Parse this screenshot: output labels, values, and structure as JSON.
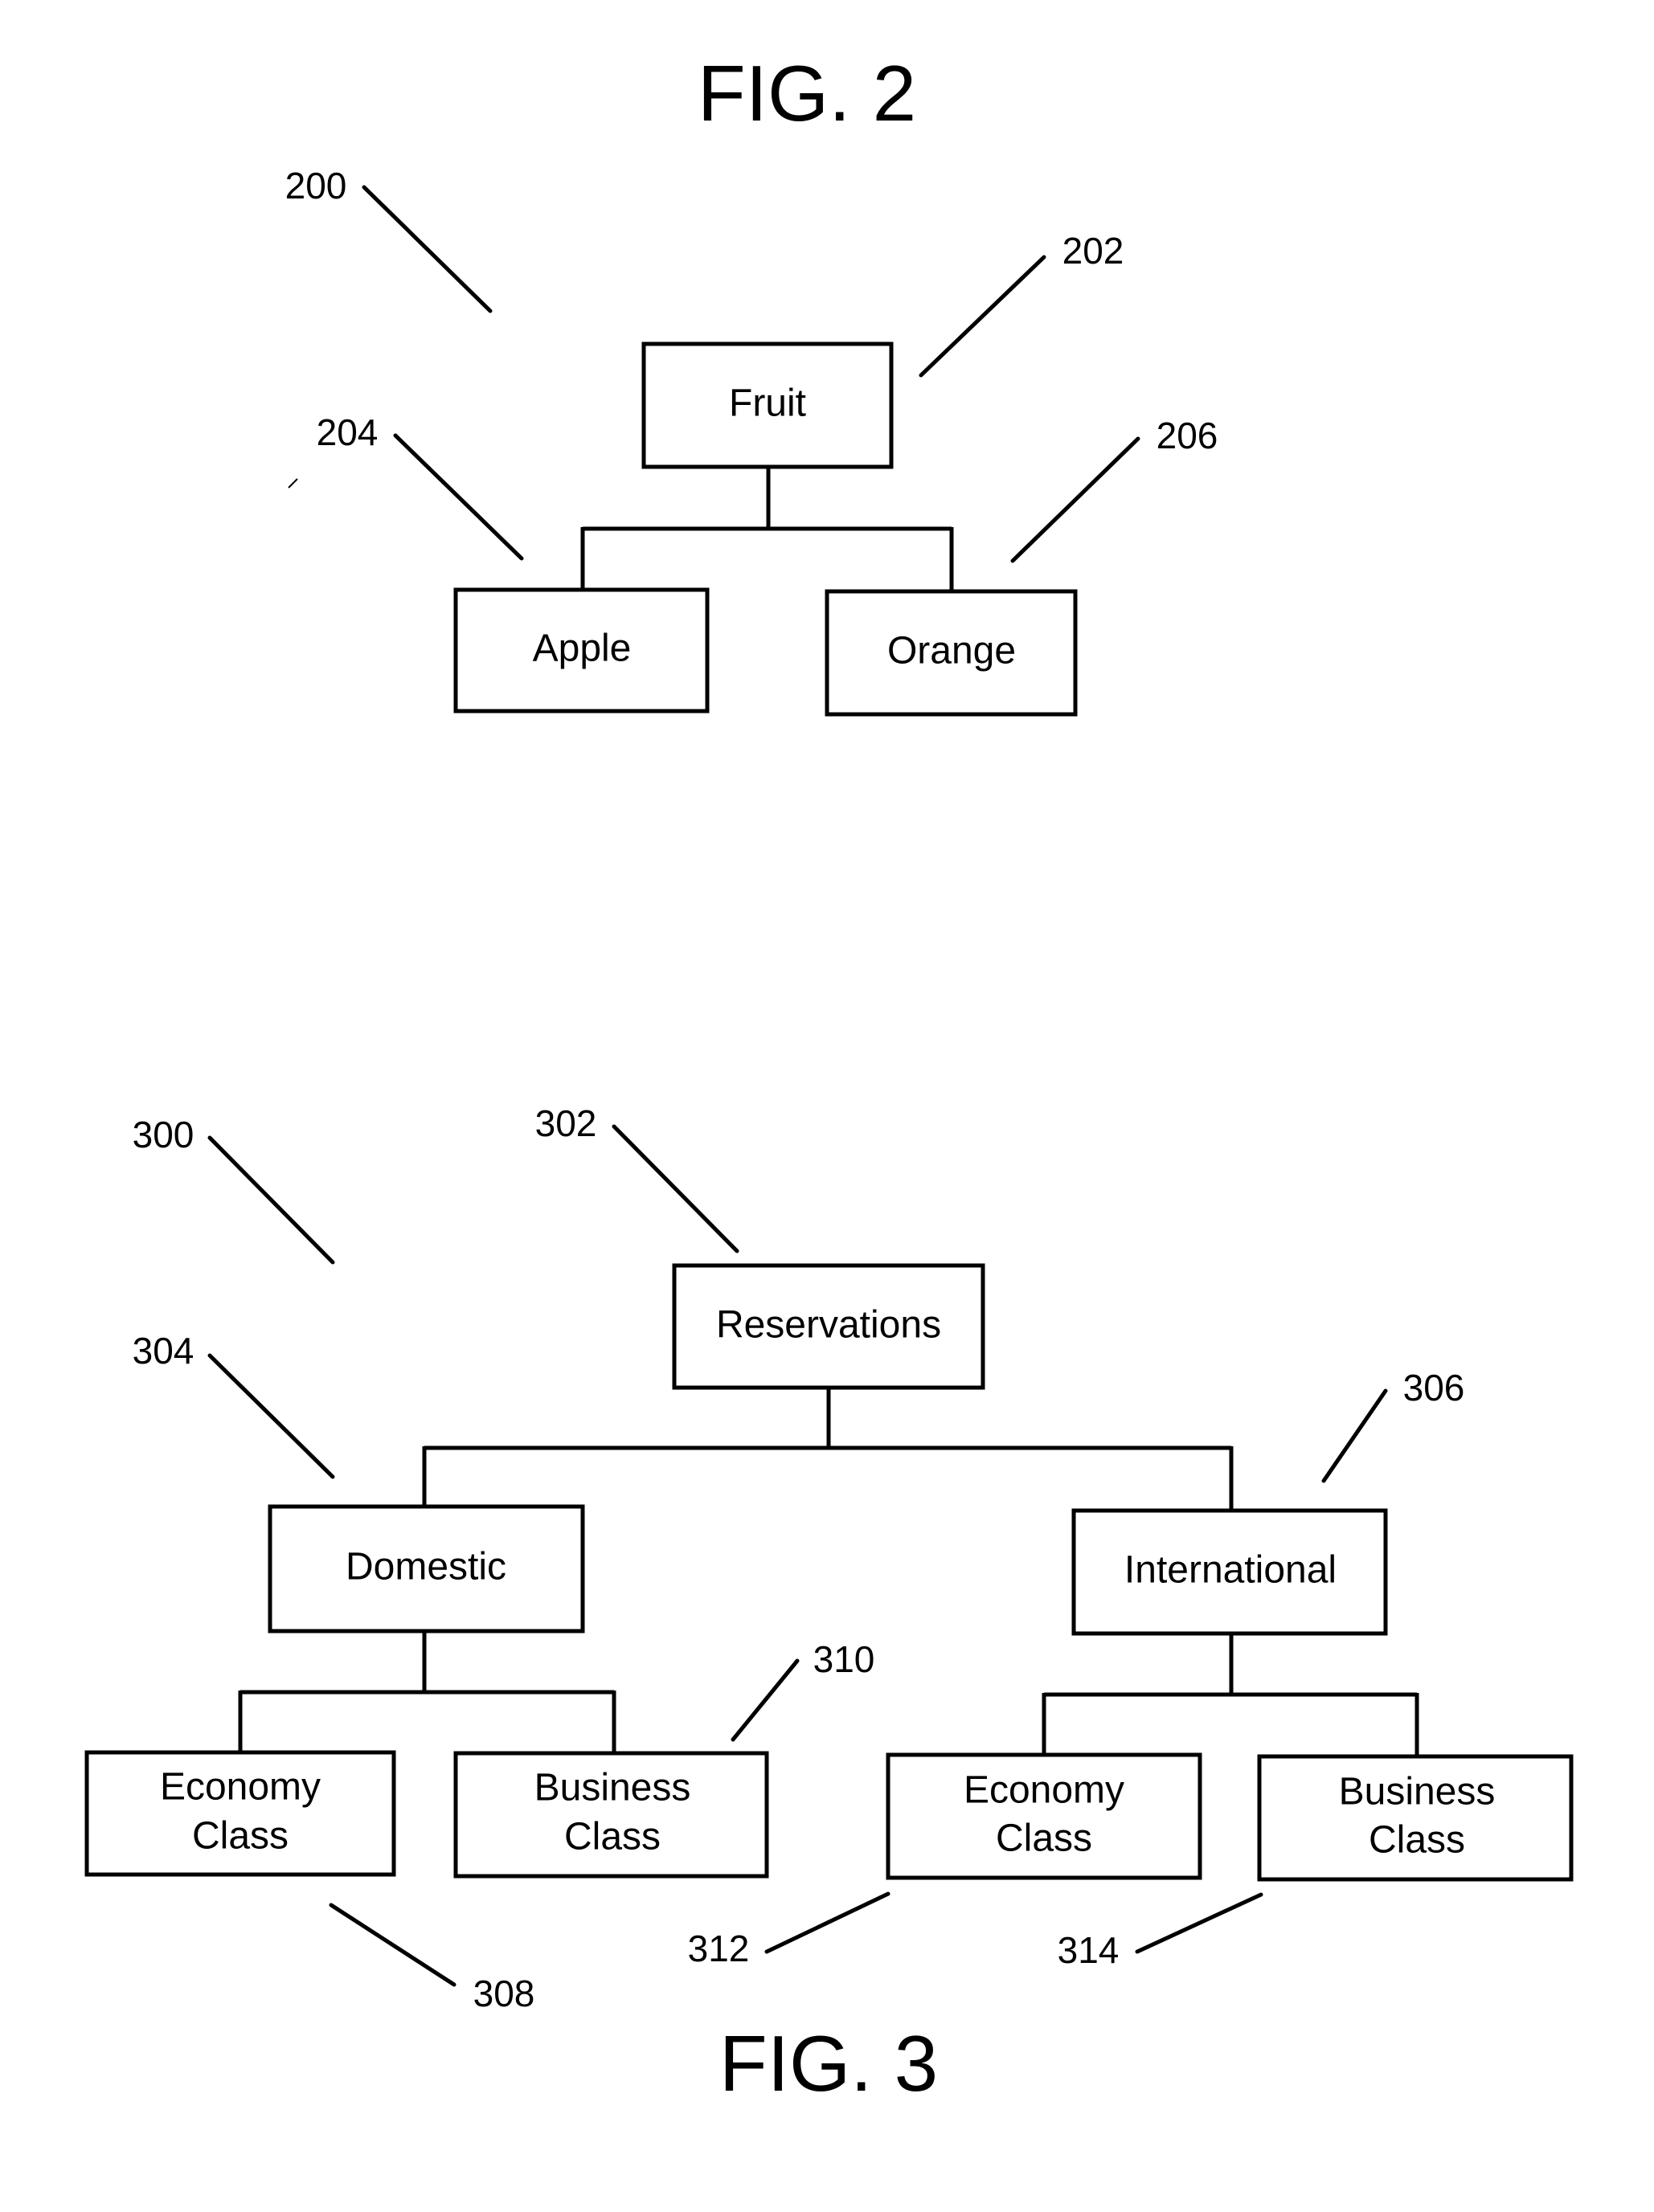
{
  "fig2": {
    "title": "FIG. 2",
    "ref_diagram": "200",
    "nodes": {
      "root": {
        "label": "Fruit",
        "ref": "202"
      },
      "left": {
        "label": "Apple",
        "ref": "204"
      },
      "right": {
        "label": "Orange",
        "ref": "206"
      }
    }
  },
  "fig3": {
    "title": "FIG. 3",
    "ref_diagram": "300",
    "nodes": {
      "root": {
        "label": "Reservations",
        "ref": "302"
      },
      "domestic": {
        "label": "Domestic",
        "ref": "304"
      },
      "international": {
        "label": "International",
        "ref": "306"
      },
      "dom_economy": {
        "line1": "Economy",
        "line2": "Class",
        "ref": "308"
      },
      "dom_business": {
        "line1": "Business",
        "line2": "Class",
        "ref": "310"
      },
      "int_economy": {
        "line1": "Economy",
        "line2": "Class",
        "ref": "312"
      },
      "int_business": {
        "line1": "Business",
        "line2": "Class",
        "ref": "314"
      }
    }
  }
}
